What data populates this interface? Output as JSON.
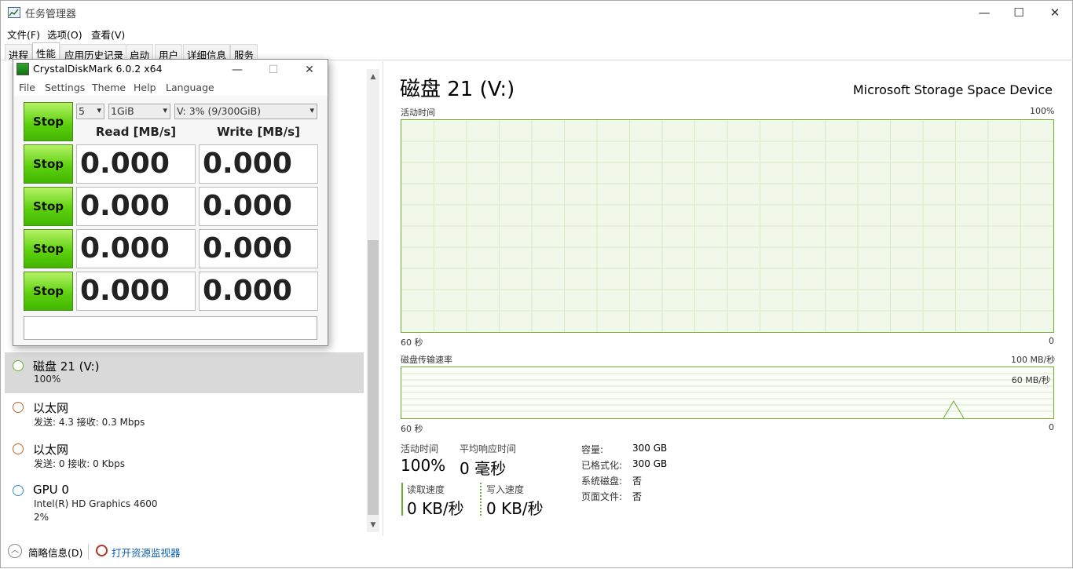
{
  "window": {
    "title": "任务管理器",
    "minimize": "—",
    "maximize": "☐",
    "close": "✕"
  },
  "menu": [
    "文件(F)",
    "选项(O)",
    "查看(V)"
  ],
  "tabs": [
    "进程",
    "性能",
    "应用历史记录",
    "启动",
    "用户",
    "详细信息",
    "服务"
  ],
  "sidebar": {
    "items": [
      {
        "name": "磁盘 21 (V:)",
        "sub1": "100%",
        "sub2": "",
        "color": "#6aae2e",
        "selected": true
      },
      {
        "name": "以太网",
        "sub1": "发送: 4.3 接收: 0.3 Mbps",
        "sub2": "",
        "color": "#c0652a"
      },
      {
        "name": "以太网",
        "sub1": "发送: 0 接收: 0 Kbps",
        "sub2": "",
        "color": "#c0652a"
      },
      {
        "name": "GPU 0",
        "sub1": "Intel(R) HD Graphics 4600",
        "sub2": "2%",
        "color": "#3a8cc9"
      }
    ]
  },
  "disk": {
    "title": "磁盘 21 (V:)",
    "model": "Microsoft Storage Space Device",
    "graph1": {
      "label": "活动时间",
      "max": "100%",
      "left_label": "60 秒",
      "right_label": "0"
    },
    "graph2": {
      "label": "磁盘传输速率",
      "max": "100 MB/秒",
      "mid": "60 MB/秒",
      "left_label": "60 秒",
      "right_label": "0"
    },
    "stats": {
      "active_label": "活动时间",
      "active_value": "100%",
      "resp_label": "平均响应时间",
      "resp_value": "0 毫秒",
      "read_label": "读取速度",
      "read_value": "0 KB/秒",
      "write_label": "写入速度",
      "write_value": "0 KB/秒"
    },
    "props": [
      {
        "label": "容量:",
        "value": "300 GB"
      },
      {
        "label": "已格式化:",
        "value": "300 GB"
      },
      {
        "label": "系统磁盘:",
        "value": "否"
      },
      {
        "label": "页面文件:",
        "value": "否"
      }
    ]
  },
  "bottom": {
    "summary": "简略信息(D)",
    "monitor": "打开资源监视器"
  },
  "cdm": {
    "title": "CrystalDiskMark 6.0.2 x64",
    "menu": [
      "File",
      "Settings",
      "Theme",
      "Help",
      "Language"
    ],
    "count": "5",
    "size": "1GiB",
    "drive": "V: 3% (9/300GiB)",
    "read_header": "Read [MB/s]",
    "write_header": "Write [MB/s]",
    "stop_label": "Stop",
    "rows": [
      {
        "read": "0.000",
        "write": "0.000"
      },
      {
        "read": "0.000",
        "write": "0.000"
      },
      {
        "read": "0.000",
        "write": "0.000"
      },
      {
        "read": "0.000",
        "write": "0.000"
      }
    ]
  }
}
